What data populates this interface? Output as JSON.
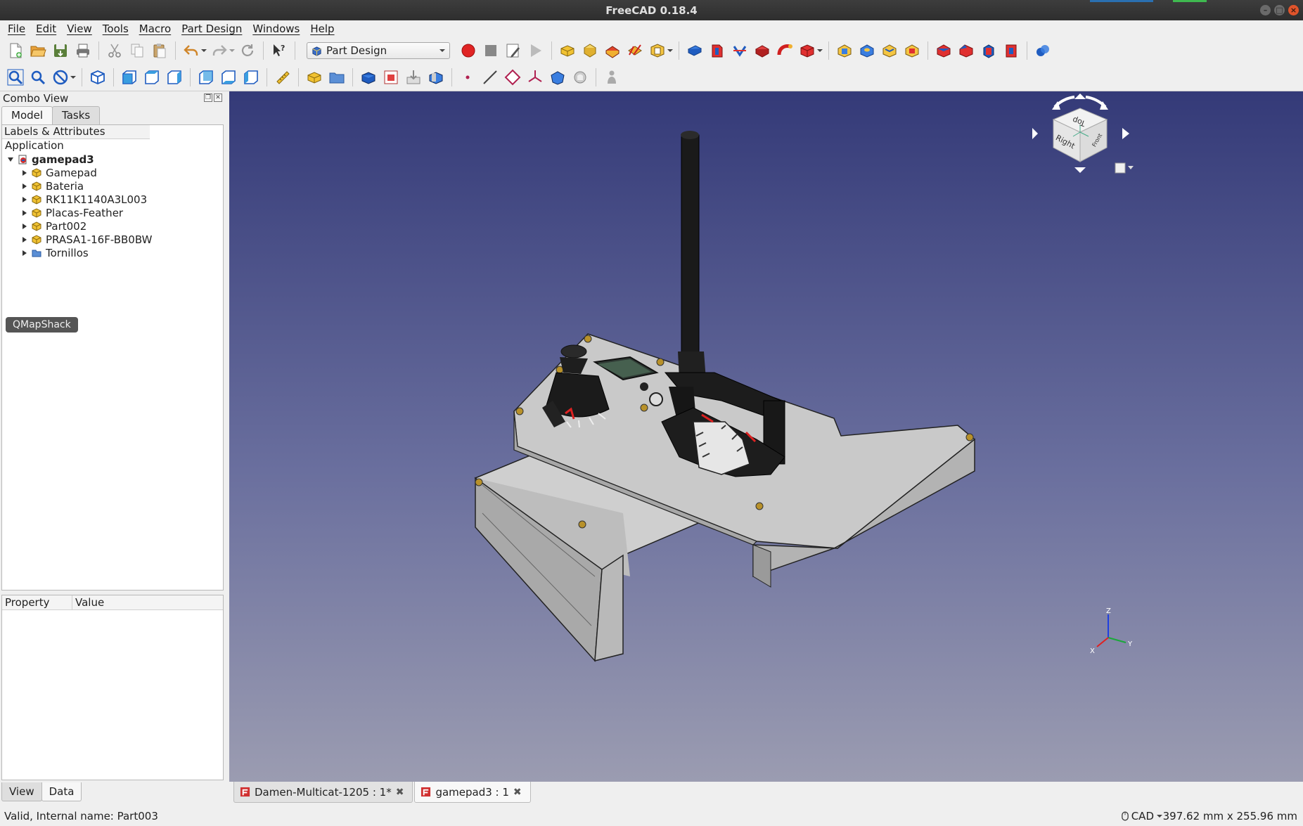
{
  "window": {
    "title": "FreeCAD 0.18.4"
  },
  "menu": [
    "File",
    "Edit",
    "View",
    "Tools",
    "Macro",
    "Part Design",
    "Windows",
    "Help"
  ],
  "toolbar": {
    "workbench": "Part Design"
  },
  "combo_view": {
    "title": "Combo View",
    "tabs": [
      "Model",
      "Tasks"
    ],
    "tree_header": "Labels & Attributes",
    "group": "Application",
    "document": "gamepad3",
    "items": [
      {
        "label": "Gamepad",
        "icon": "part-icon"
      },
      {
        "label": "Bateria",
        "icon": "part-icon"
      },
      {
        "label": "RK11K1140A3L003",
        "icon": "part-icon"
      },
      {
        "label": "Placas-Feather",
        "icon": "part-icon"
      },
      {
        "label": "Part002",
        "icon": "part-icon"
      },
      {
        "label": "PRASA1-16F-BB0BW",
        "icon": "part-icon"
      },
      {
        "label": "Tornillos",
        "icon": "folder-icon"
      }
    ],
    "tooltip": "QMapShack",
    "property_headers": [
      "Property",
      "Value"
    ],
    "bottom_tabs": [
      "View",
      "Data"
    ]
  },
  "nav_cube": {
    "faces": [
      "Top",
      "Right",
      "Front"
    ],
    "axes": [
      "Z",
      "Y",
      "X"
    ]
  },
  "doc_tabs": [
    {
      "label": "Damen-Multicat-1205 : 1*",
      "active": false
    },
    {
      "label": "gamepad3 : 1",
      "active": true
    }
  ],
  "status": {
    "message": "Valid, Internal name: Part003",
    "nav_style": "CAD",
    "dimensions": "397.62 mm x 255.96 mm"
  },
  "colors": {
    "viewport_top": "#343a78",
    "viewport_bottom": "#9b9cb1",
    "model_body": "#c9c9c9",
    "model_dark": "#1a1a1a"
  }
}
